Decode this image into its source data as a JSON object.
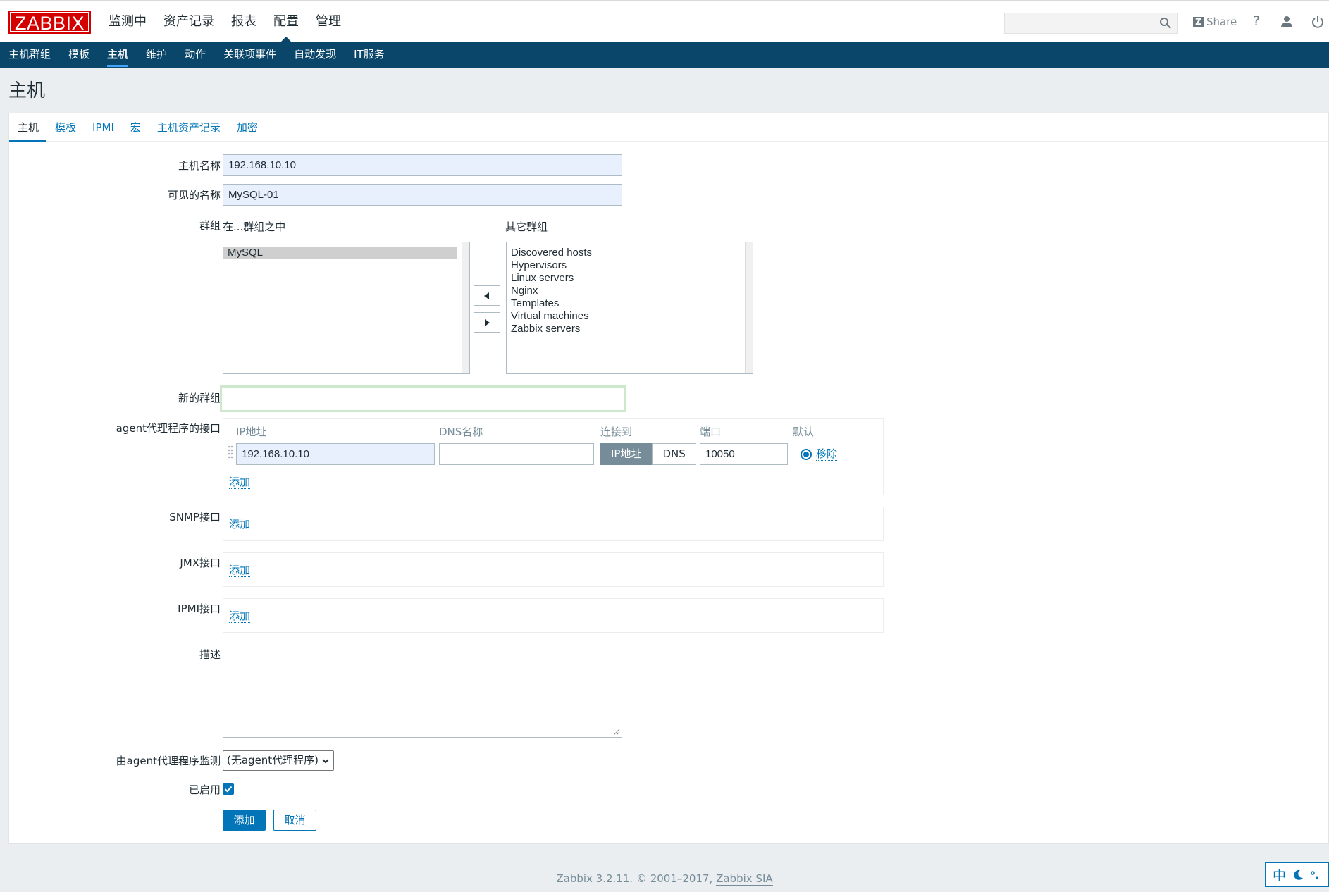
{
  "logo": "ZABBIX",
  "main_nav": [
    "监测中",
    "资产记录",
    "报表",
    "配置",
    "管理"
  ],
  "search": {
    "value": ""
  },
  "header": {
    "share": "Share",
    "help": "?"
  },
  "sub_nav": [
    "主机群组",
    "模板",
    "主机",
    "维护",
    "动作",
    "关联项事件",
    "自动发现",
    "IT服务"
  ],
  "page_title": "主机",
  "tabs": [
    "主机",
    "模板",
    "IPMI",
    "宏",
    "主机资产记录",
    "加密"
  ],
  "form": {
    "host_name_label": "主机名称",
    "host_name": "192.168.10.10",
    "visible_name_label": "可见的名称",
    "visible_name": "MySQL-01",
    "groups_label": "群组",
    "in_groups_label": "在...群组之中",
    "other_groups_label": "其它群组",
    "in_groups": [
      "MySQL"
    ],
    "other_groups": [
      "Discovered hosts",
      "Hypervisors",
      "Linux servers",
      "Nginx",
      "Templates",
      "Virtual machines",
      "Zabbix servers"
    ],
    "new_group_label": "新的群组",
    "new_group": "",
    "agent_label": "agent代理程序的接口",
    "col_ip": "IP地址",
    "col_dns": "DNS名称",
    "col_connect": "连接到",
    "col_port": "端口",
    "col_default": "默认",
    "agent_ip": "192.168.10.10",
    "agent_dns": "",
    "connect_ip": "IP地址",
    "connect_dns": "DNS",
    "agent_port": "10050",
    "remove": "移除",
    "add": "添加",
    "snmp_label": "SNMP接口",
    "jmx_label": "JMX接口",
    "ipmi_label": "IPMI接口",
    "description_label": "描述",
    "proxy_label": "由agent代理程序监测",
    "proxy_value": "(无agent代理程序)",
    "enabled_label": "已启用",
    "submit": "添加",
    "cancel": "取消"
  },
  "footer": {
    "text": "Zabbix 3.2.11. © 2001–2017, ",
    "link": "Zabbix SIA"
  },
  "ime": {
    "lang": "中"
  }
}
